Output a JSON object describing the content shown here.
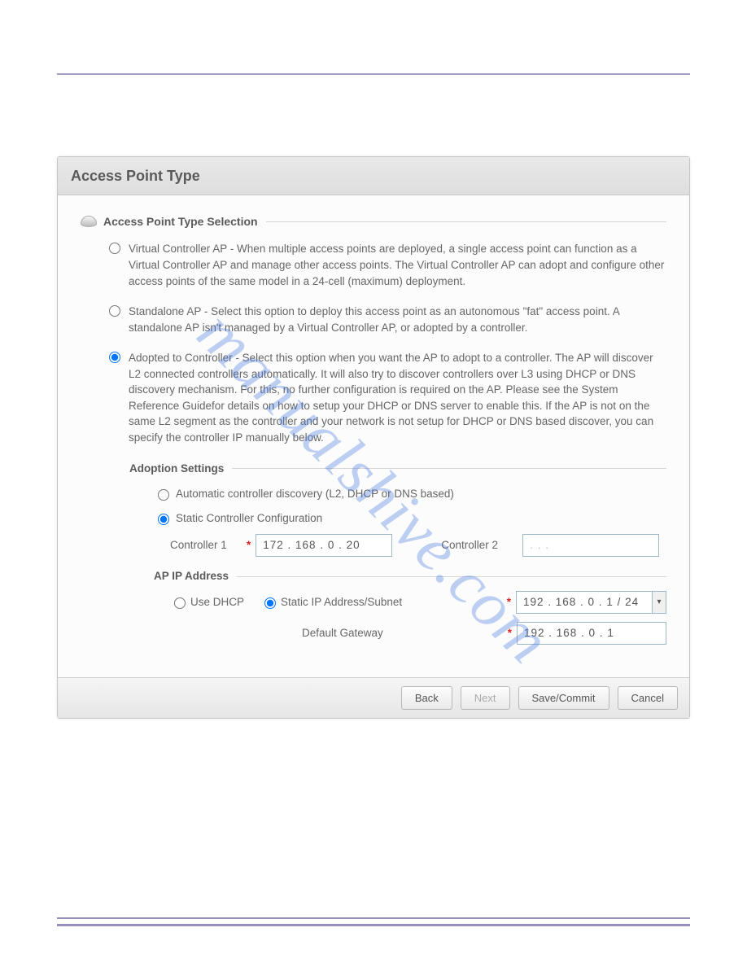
{
  "watermark": "manualshive.com",
  "panel": {
    "title": "Access Point Type",
    "section_title": "Access Point Type Selection",
    "options": {
      "virtual": "Virtual Controller AP - When multiple access points are deployed, a single access point can function as a Virtual Controller AP and manage other access points. The Virtual Controller AP can adopt and configure other access points of the same model in a 24-cell (maximum) deployment.",
      "standalone": "Standalone AP - Select this option to deploy this access point as an autonomous \"fat\" access point. A standalone AP isn't managed by a Virtual Controller AP, or adopted by a controller.",
      "adopted": "Adopted to Controller - Select this option when you want the AP to adopt to a controller. The AP will discover L2 connected controllers automatically. It will also try to discover controllers over L3 using DHCP or DNS discovery mechanism. For this, no further configuration is required on the AP. Please see the System Reference Guidefor details on how to setup your DHCP or DNS server to enable this. If the AP is not on the same L2 segment as the controller and your network is not setup for DHCP or DNS based discover, you can specify the controller IP manually below."
    },
    "adoption": {
      "title": "Adoption Settings",
      "auto_label": "Automatic controller discovery (L2, DHCP or DNS based)",
      "static_label": "Static Controller Configuration",
      "controller1_label": "Controller 1",
      "controller1_ip": "172 . 168 .   0   .   20",
      "controller2_label": "Controller 2",
      "controller2_ip": ".       .       ."
    },
    "apip": {
      "title": "AP IP Address",
      "dhcp_label": "Use DHCP",
      "static_label": "Static IP Address/Subnet",
      "static_ip": "192 . 168 .   0   .   1  /  24",
      "gateway_label": "Default Gateway",
      "gateway_ip": "192 . 168 .   0   .   1"
    }
  },
  "buttons": {
    "back": "Back",
    "next": "Next",
    "save": "Save/Commit",
    "cancel": "Cancel"
  }
}
